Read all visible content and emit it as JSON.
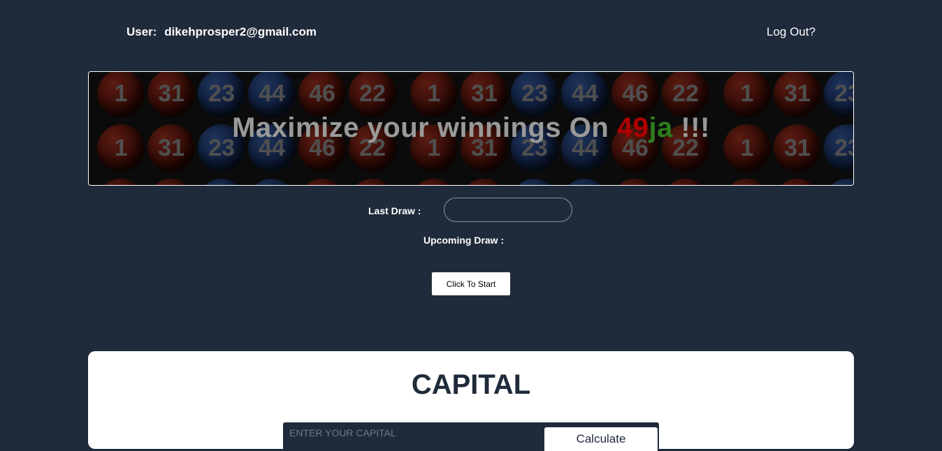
{
  "header": {
    "user_label": "User:",
    "user_email": "dikehprosper2@gmail.com",
    "logout_label": "Log Out?"
  },
  "banner": {
    "title_prefix": "Maximize your winnings On ",
    "title_49": "49",
    "title_ja": "ja",
    "title_suffix": " !!!",
    "ball_numbers": [
      "1",
      "31",
      "23",
      "44",
      "46",
      "22"
    ],
    "ball_colors": [
      "red",
      "red",
      "blue",
      "blue",
      "red",
      "red"
    ]
  },
  "draw": {
    "last_draw_label": "Last Draw :",
    "last_draw_value": "",
    "upcoming_draw_label": "Upcoming Draw :",
    "start_button": "Click To Start"
  },
  "capital": {
    "title": "CAPITAL",
    "input_placeholder": "ENTER YOUR CAPITAL",
    "calculate_button": "Calculate"
  },
  "colors": {
    "background": "#1f2a3a",
    "accent_red": "#b00000",
    "accent_green": "#2e7d1e"
  }
}
